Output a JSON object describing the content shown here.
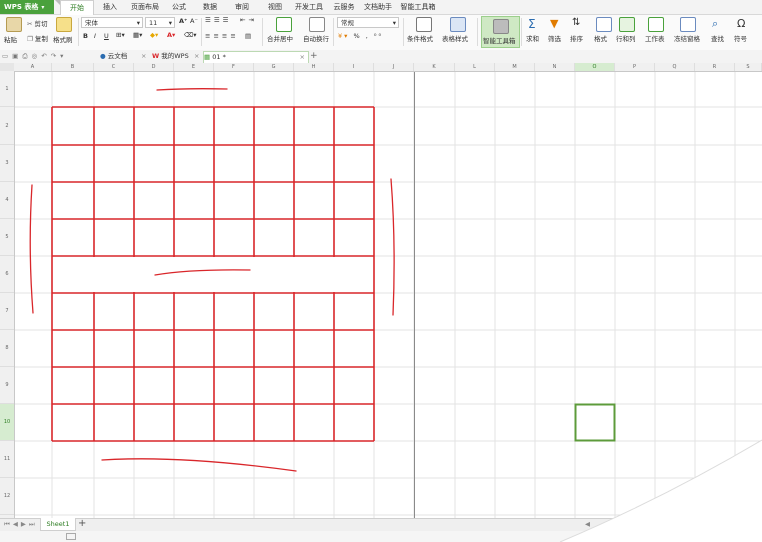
{
  "app": {
    "logo": "WPS 表格"
  },
  "menu_tabs": [
    "开始",
    "插入",
    "页面布局",
    "公式",
    "数据",
    "审阅",
    "视图",
    "开发工具",
    "云服务",
    "文档助手",
    "智能工具箱"
  ],
  "ribbon": {
    "paste": "粘贴",
    "cut": "剪切",
    "copy": "复制",
    "format_painter": "格式刷",
    "font_name": "宋体",
    "font_size": "11",
    "merge_center": "合并居中",
    "wrap_text": "自动换行",
    "number_format": "常规",
    "conditional_format": "条件格式",
    "table_style": "表格样式",
    "smart_toolbox": "智能工具箱",
    "sum": "求和",
    "filter": "筛选",
    "sort": "排序",
    "format": "格式",
    "row_col": "行和列",
    "worksheet": "工作表",
    "freeze": "冻结窗格",
    "find": "查找",
    "symbol": "符号"
  },
  "doc_tabs": {
    "cloud": "云文档",
    "mywps": "我的WPS",
    "file": "01 *"
  },
  "col_headers": [
    "A",
    "B",
    "C",
    "D",
    "E",
    "F",
    "G",
    "H",
    "I",
    "J",
    "K",
    "L",
    "M",
    "N",
    "O",
    "P",
    "Q",
    "R",
    "S",
    "T"
  ],
  "row_headers": [
    "1",
    "2",
    "3",
    "4",
    "5",
    "6",
    "7",
    "8",
    "9",
    "10",
    "11",
    "12"
  ],
  "sheet_tab": "Sheet1",
  "colors": {
    "accent_green": "#4aa13c",
    "grid_red": "#d9262a",
    "selection": "#5d9b3b"
  }
}
